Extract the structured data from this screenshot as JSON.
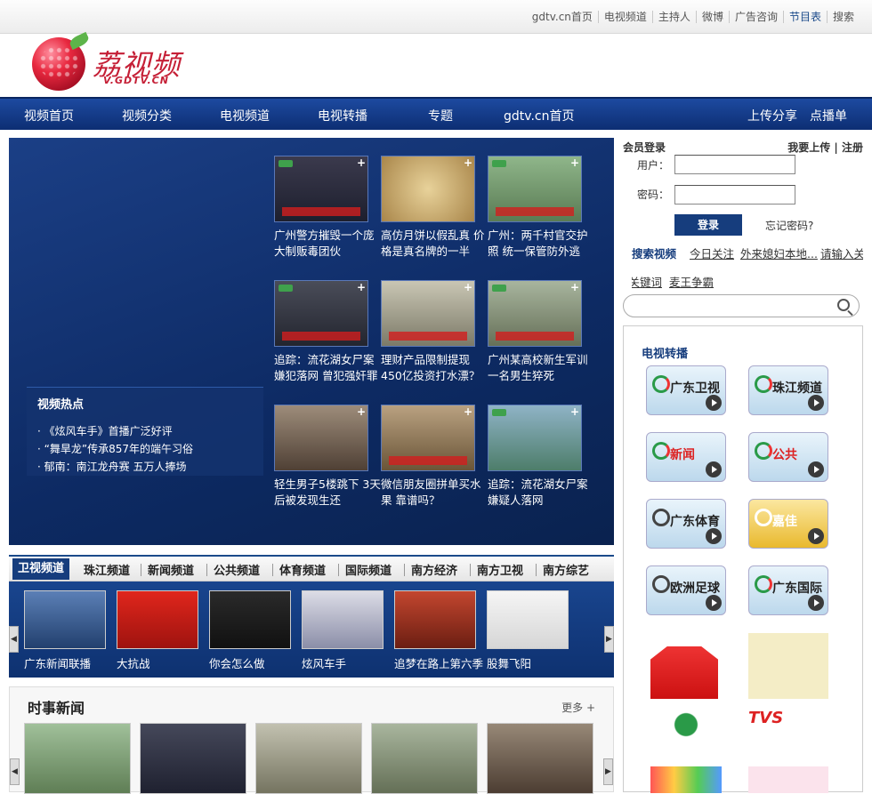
{
  "toplinks": [
    "gdtv.cn首页",
    "电视频道",
    "主持人",
    "微博",
    "广告咨询",
    "节目表",
    "搜索"
  ],
  "logo": {
    "cn": "荔视频",
    "en": "V.GDTV.CN"
  },
  "nav": {
    "items": [
      "视频首页",
      "视频分类",
      "电视频道",
      "电视转播",
      "专题",
      "gdtv.cn首页"
    ],
    "right": [
      "上传分享",
      "点播单"
    ]
  },
  "hot": {
    "title": "视频热点",
    "items": [
      "《炫风车手》首播广泛好评",
      "“舞旱龙”传承857年的端午习俗",
      "郁南：南江龙舟赛 五万人捧场"
    ]
  },
  "tiles": [
    "广州警方摧毁一个庞大制贩毒团伙",
    "高仿月饼以假乱真 价格是真名牌的一半",
    "广州：两千村官交护照 统一保管防外逃",
    "追踪：流花湖女尸案嫌犯落网 曾犯强奸罪",
    "理财产品限制提现 450亿投资打水漂？",
    "广州某高校新生军训 一名男生猝死",
    "轻生男子5楼跳下 3天后被发现生还",
    "微信朋友圈拼单买水果 靠谱吗？",
    "追踪：流花湖女尸案 嫌疑人落网"
  ],
  "tabs": [
    "卫视频道",
    "珠江频道",
    "新闻频道",
    "公共频道",
    "体育频道",
    "国际频道",
    "南方经济",
    "南方卫视",
    "南方综艺"
  ],
  "channels": [
    "广东新闻联播",
    "大抗战",
    "你会怎么做",
    "炫风车手",
    "追梦在路上第六季",
    "股舞飞阳"
  ],
  "news": {
    "title": "时事新闻",
    "more": "更多"
  },
  "login": {
    "title": "会员登录",
    "right": "我要上传 | 注册",
    "user_label": "用户：",
    "pass_label": "密码：",
    "button": "登录",
    "forgot": "忘记密码?"
  },
  "search": {
    "label": "搜索视频",
    "keywords": [
      "今日关注",
      "外来媳妇本地...",
      "请输入关键词...",
      "麦王争霸"
    ]
  },
  "tv": {
    "title": "电视转播",
    "logos": [
      "广东卫视",
      "珠江频道",
      "新闻",
      "公共",
      "广东体育",
      "嘉佳",
      "欧洲足球",
      "广东国际"
    ]
  }
}
